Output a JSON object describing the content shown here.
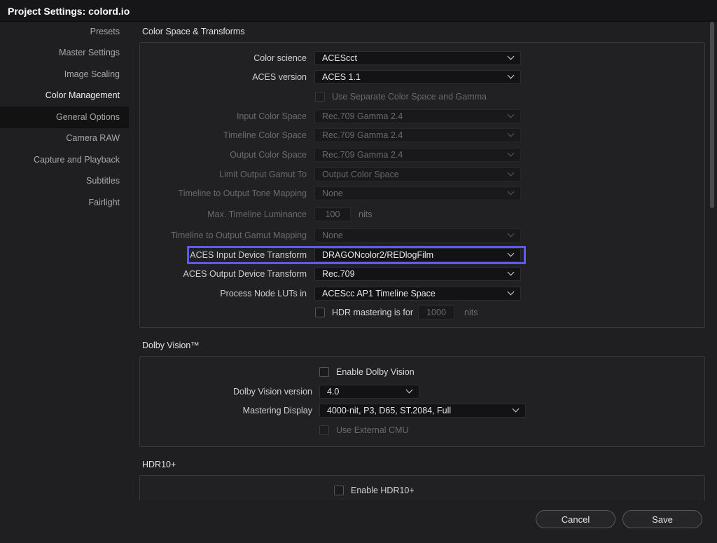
{
  "window": {
    "title": "Project Settings:  colord.io"
  },
  "sidebar": {
    "items": [
      {
        "label": "Presets"
      },
      {
        "label": "Master Settings"
      },
      {
        "label": "Image Scaling"
      },
      {
        "label": "Color Management",
        "active": true
      },
      {
        "label": "General Options"
      },
      {
        "label": "Camera RAW"
      },
      {
        "label": "Capture and Playback"
      },
      {
        "label": "Subtitles"
      },
      {
        "label": "Fairlight"
      }
    ]
  },
  "color_space": {
    "title": "Color Space & Transforms",
    "color_science": {
      "label": "Color science",
      "value": "ACEScct"
    },
    "aces_version": {
      "label": "ACES version",
      "value": "ACES 1.1"
    },
    "separate_cs": {
      "label": "Use Separate Color Space and Gamma"
    },
    "input_cs": {
      "label": "Input Color Space",
      "value": "Rec.709 Gamma 2.4"
    },
    "timeline_cs": {
      "label": "Timeline Color Space",
      "value": "Rec.709 Gamma 2.4"
    },
    "output_cs": {
      "label": "Output Color Space",
      "value": "Rec.709 Gamma 2.4"
    },
    "limit_gamut": {
      "label": "Limit Output Gamut To",
      "value": "Output Color Space"
    },
    "tone_mapping": {
      "label": "Timeline to Output Tone Mapping",
      "value": "None"
    },
    "max_luminance": {
      "label": "Max. Timeline Luminance",
      "value": "100",
      "unit": "nits"
    },
    "gamut_mapping": {
      "label": "Timeline to Output Gamut Mapping",
      "value": "None"
    },
    "idt": {
      "label": "ACES Input Device Transform",
      "value": "DRAGONcolor2/REDlogFilm"
    },
    "odt": {
      "label": "ACES Output Device Transform",
      "value": "Rec.709"
    },
    "process_luts": {
      "label": "Process Node LUTs in",
      "value": "ACEScc AP1 Timeline Space"
    },
    "hdr_mastering": {
      "label": "HDR mastering is for",
      "value": "1000",
      "unit": "nits"
    }
  },
  "dolby": {
    "title": "Dolby Vision™",
    "enable": {
      "label": "Enable Dolby Vision"
    },
    "version": {
      "label": "Dolby Vision version",
      "value": "4.0"
    },
    "mastering_display": {
      "label": "Mastering Display",
      "value": "4000-nit, P3, D65, ST.2084, Full"
    },
    "external_cmu": {
      "label": "Use External CMU"
    }
  },
  "hdr10": {
    "title": "HDR10+",
    "enable": {
      "label": "Enable HDR10+"
    }
  },
  "footer": {
    "cancel_label": "Cancel",
    "save_label": "Save"
  },
  "colors": {
    "highlight": "#5b5bf0",
    "background": "#1f1f21",
    "titlebar": "#161618"
  }
}
